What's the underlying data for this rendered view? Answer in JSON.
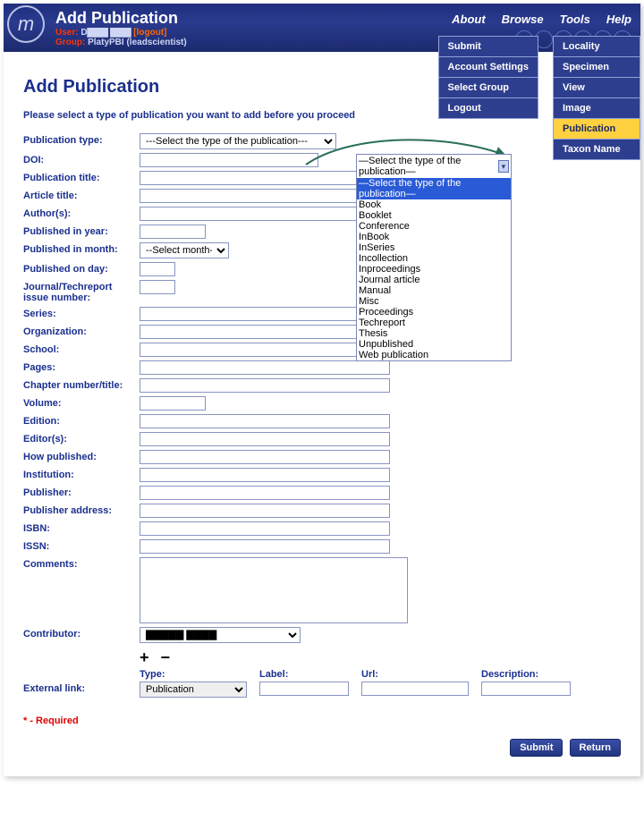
{
  "header": {
    "title": "Add Publication",
    "user_label": "User:",
    "user_value": "D▇▇▇ ▇▇▇",
    "logout": "[logout]",
    "group_label": "Group:",
    "group_value": "PlatyPBI (leadscientist)"
  },
  "topnav": [
    "About",
    "Browse",
    "Tools",
    "Help"
  ],
  "submenu_tools": [
    "Submit",
    "Account Settings",
    "Select Group",
    "Logout"
  ],
  "submenu_help": [
    "Locality",
    "Specimen",
    "View",
    "Image",
    "Publication",
    "Taxon Name"
  ],
  "submenu_help_active": "Publication",
  "page": {
    "heading": "Add Publication",
    "instruction": "Please select a type of publication you want to add before you proceed"
  },
  "pubtype_select": {
    "label": "Publication type:",
    "placeholder": "---Select the type of the publication---",
    "options": [
      "—Select the type of the publication—",
      "Book",
      "Booklet",
      "Conference",
      "InBook",
      "InSeries",
      "Incollection",
      "Inproceedings",
      "Journal article",
      "Manual",
      "Misc",
      "Proceedings",
      "Techreport",
      "Thesis",
      "Unpublished",
      "Web publication"
    ]
  },
  "fields": {
    "doi": "DOI:",
    "pub_title": "Publication title:",
    "article_title": "Article title:",
    "authors": "Author(s):",
    "year": "Published in year:",
    "month_label": "Published in month:",
    "month_value": "--Select month--",
    "day": "Published on day:",
    "issue": "Journal/Techreport issue number:",
    "series": "Series:",
    "org": "Organization:",
    "school": "School:",
    "pages": "Pages:",
    "chapter": "Chapter number/title:",
    "volume": "Volume:",
    "edition": "Edition:",
    "editors": "Editor(s):",
    "how": "How published:",
    "institution": "Institution:",
    "publisher": "Publisher:",
    "pub_addr": "Publisher address:",
    "isbn": "ISBN:",
    "issn": "ISSN:",
    "comments": "Comments:",
    "contributor": "Contributor:",
    "contributor_value": "▇▇▇▇▇ ▇▇▇▇"
  },
  "external": {
    "section": "External link:",
    "type": "Type:",
    "type_value": "Publication",
    "label": "Label:",
    "url": "Url:",
    "desc": "Description:"
  },
  "required_note": "* - Required",
  "buttons": {
    "submit": "Submit",
    "return": "Return"
  }
}
